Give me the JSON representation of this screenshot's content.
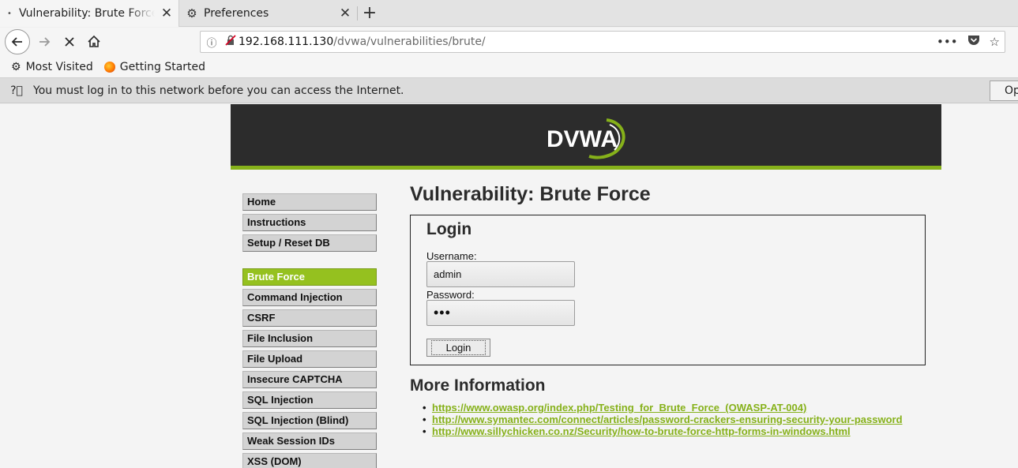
{
  "browser": {
    "tabs": [
      {
        "title": "Vulnerability: Brute Force",
        "active": true
      },
      {
        "title": "Preferences",
        "active": false
      }
    ],
    "url": {
      "host": "192.168.111.130",
      "path": "/dvwa/vulnerabilities/brute/"
    },
    "bookmarks": [
      {
        "label": "Most Visited",
        "icon": "gear-icon"
      },
      {
        "label": "Getting Started",
        "icon": "firefox-icon"
      }
    ],
    "notice": {
      "text": "You must log in to this network before you can access the Internet.",
      "button": "Open"
    }
  },
  "site": {
    "logo_text": "DVWA",
    "accent_color": "#86b11a",
    "header_color": "#2c2c2c"
  },
  "menu": {
    "group1": [
      "Home",
      "Instructions",
      "Setup / Reset DB"
    ],
    "group2": [
      "Brute Force",
      "Command Injection",
      "CSRF",
      "File Inclusion",
      "File Upload",
      "Insecure CAPTCHA",
      "SQL Injection",
      "SQL Injection (Blind)",
      "Weak Session IDs",
      "XSS (DOM)"
    ],
    "selected": "Brute Force"
  },
  "main": {
    "title": "Vulnerability: Brute Force",
    "login": {
      "heading": "Login",
      "username_label": "Username:",
      "username_value": "admin",
      "password_label": "Password:",
      "password_mask": "•••",
      "button": "Login"
    },
    "more_info_title": "More Information",
    "links": [
      "https://www.owasp.org/index.php/Testing_for_Brute_Force_(OWASP-AT-004)",
      "http://www.symantec.com/connect/articles/password-crackers-ensuring-security-your-password",
      "http://www.sillychicken.co.nz/Security/how-to-brute-force-http-forms-in-windows.html"
    ]
  }
}
